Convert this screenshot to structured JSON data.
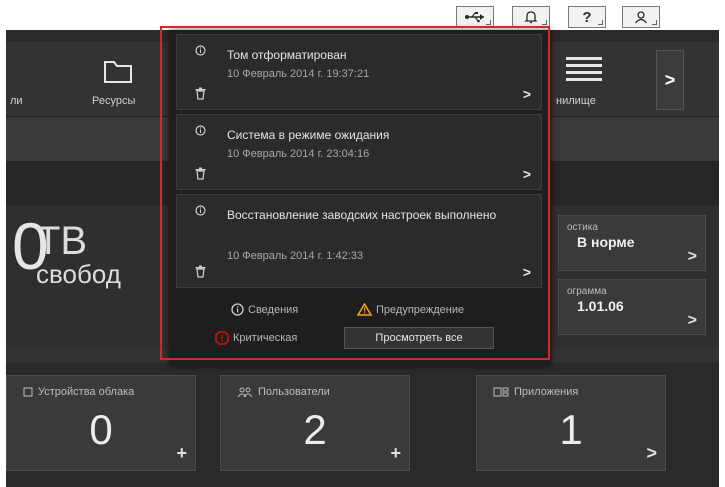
{
  "header": {
    "buttons": [
      {
        "icon": "usb-icon"
      },
      {
        "icon": "bell-icon"
      },
      {
        "icon": "help-icon",
        "label": "?"
      },
      {
        "icon": "user-icon"
      }
    ]
  },
  "nav": {
    "items": [
      {
        "label": "ли"
      },
      {
        "label": "Ресурсы",
        "icon": "folder-icon"
      },
      {
        "label": "нилище",
        "icon": "storage-icon"
      }
    ],
    "more": ">"
  },
  "storage": {
    "value_partial": "0",
    "unit": "TB",
    "free_label": "свобод"
  },
  "stat_cards": [
    {
      "key": "остика",
      "value": "В норме",
      "chevron": ">"
    },
    {
      "key": "ограмма",
      "value": "1.01.06",
      "chevron": ">"
    }
  ],
  "bottom_cards": [
    {
      "title": "Устройства облака",
      "count": "0",
      "action": "+",
      "icon": "cloud-device-icon"
    },
    {
      "title": "Пользователи",
      "count": "2",
      "action": "+",
      "icon": "users-icon"
    },
    {
      "title": "Приложения",
      "count": "1",
      "action": ">",
      "icon": "apps-icon"
    }
  ],
  "popup": {
    "notifications": [
      {
        "message": "Том отформатирован",
        "time": "10 Февраль 2014 г. 19:37:21",
        "level": "info"
      },
      {
        "message": "Система в режиме ожидания",
        "time": "10 Февраль 2014 г. 23:04:16",
        "level": "info"
      },
      {
        "message": "Восстановление заводских настроек выполнено",
        "time": "10 Февраль 2014 г. 1:42:33",
        "level": "info"
      }
    ],
    "go_label": ">",
    "legend": {
      "info": "Сведения",
      "warning": "Предупреждение",
      "critical": "Критическая"
    },
    "view_all": "Просмотреть все"
  },
  "colors": {
    "highlight_outline": "#d22a2a",
    "warning": "#f0a020",
    "critical": "#d01010"
  }
}
